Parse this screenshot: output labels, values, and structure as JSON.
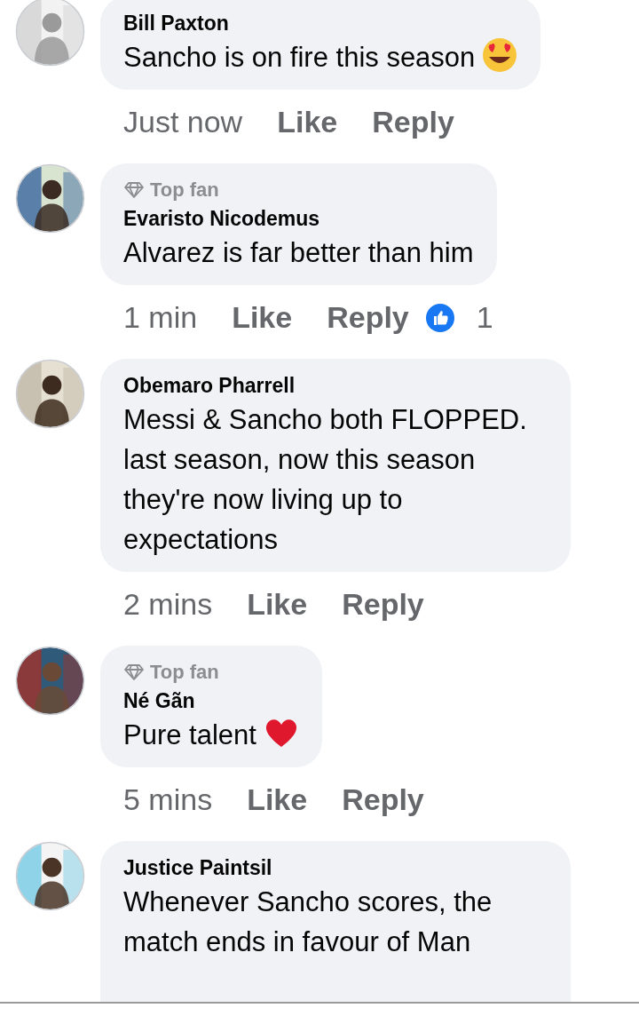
{
  "comments": [
    {
      "name": "Bill Paxton",
      "text": "Sancho is on fire this season",
      "emoji": {
        "kind": "heart_eyes"
      },
      "time": "Just now",
      "like": "Like",
      "reply": "Reply"
    },
    {
      "badge": "Top fan",
      "name": "Evaristo Nicodemus",
      "text": "Alvarez is far better than him",
      "time": "1 min",
      "like": "Like",
      "reply": "Reply",
      "reactions": "1"
    },
    {
      "name": "Obemaro Pharrell",
      "text": "Messi & Sancho both FLOPPED. last season, now this season they're now living up to expectations",
      "time": "2 mins",
      "like": "Like",
      "reply": "Reply"
    },
    {
      "badge": "Top fan",
      "name": "Né Gãn",
      "text": "Pure talent",
      "emoji": {
        "kind": "heart"
      },
      "time": "5 mins",
      "like": "Like",
      "reply": "Reply"
    },
    {
      "name": "Justice Paintsil",
      "text": "Whenever Sancho scores, the match ends in favour of Man"
    }
  ]
}
